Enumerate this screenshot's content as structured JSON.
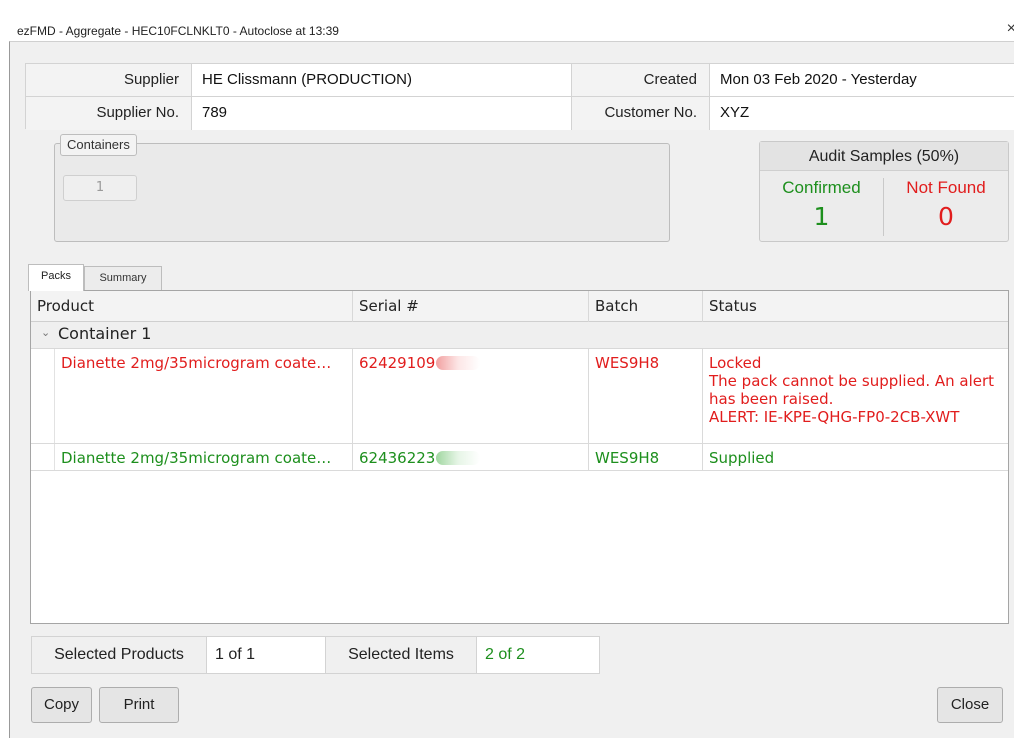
{
  "window": {
    "title": "ezFMD - Aggregate - HEC10FCLNKLT0 - Autoclose at 13:39",
    "close_glyph": "×"
  },
  "info": {
    "supplier_label": "Supplier",
    "supplier_value": "HE Clissmann (PRODUCTION)",
    "created_label": "Created",
    "created_value": "Mon 03 Feb 2020 - Yesterday",
    "supplier_no_label": "Supplier No.",
    "supplier_no_value": "789",
    "customer_no_label": "Customer No.",
    "customer_no_value": "XYZ"
  },
  "containers": {
    "title": "Containers",
    "items": [
      "1"
    ]
  },
  "audit": {
    "title": "Audit Samples (50%)",
    "confirmed_label": "Confirmed",
    "confirmed_value": "1",
    "not_found_label": "Not Found",
    "not_found_value": "0",
    "colors": {
      "confirmed": "#1d8f1d",
      "not_found": "#e11d1d"
    }
  },
  "tabs": [
    {
      "label": "Packs",
      "active": true
    },
    {
      "label": "Summary",
      "active": false
    }
  ],
  "grid": {
    "columns": [
      "Product",
      "Serial #",
      "Batch",
      "Status"
    ],
    "group": {
      "name": "Container 1",
      "icon": "chevron-down-icon",
      "chevron_glyph": "⌄"
    },
    "rows": [
      {
        "product": "Dianette 2mg/35microgram coate…",
        "serial_visible": "62429109",
        "batch": "WES9H8",
        "status_lines": [
          "Locked",
          "The pack cannot be supplied. An alert has been raised.",
          "ALERT: IE-KPE-QHG-FP0-2CB-XWT"
        ],
        "color": "#e11d1d"
      },
      {
        "product": "Dianette 2mg/35microgram coate…",
        "serial_visible": "62436223",
        "batch": "WES9H8",
        "status_lines": [
          "Supplied"
        ],
        "color": "#1d8f1d"
      }
    ]
  },
  "footer": {
    "selected_products_label": "Selected Products",
    "selected_products_value": "1 of 1",
    "selected_items_label": "Selected Items",
    "selected_items_value": "2 of 2",
    "selected_items_color": "#1d8f1d"
  },
  "buttons": {
    "copy": "Copy",
    "print": "Print",
    "close": "Close"
  }
}
